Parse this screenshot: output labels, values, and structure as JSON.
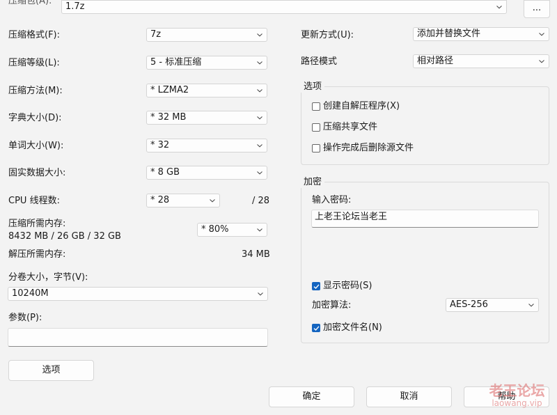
{
  "archive": {
    "label": "压缩包(A):",
    "path": "1.7z",
    "browse_label": "..."
  },
  "left": {
    "format": {
      "label": "压缩格式(F):",
      "value": "7z"
    },
    "level": {
      "label": "压缩等级(L):",
      "value": "5 - 标准压缩"
    },
    "method": {
      "label": "压缩方法(M):",
      "value": "*  LZMA2"
    },
    "dict": {
      "label": "字典大小(D):",
      "value": "*  32 MB"
    },
    "word": {
      "label": "单词大小(W):",
      "value": "*  32"
    },
    "solid": {
      "label": "固实数据大小:",
      "value": "*  8 GB"
    },
    "threads": {
      "label": "CPU 线程数:",
      "value": "*  28",
      "max": "/ 28"
    },
    "mem_compress": {
      "label": "压缩所需内存:",
      "detail": "8432 MB / 26 GB / 32 GB",
      "value": "*  80%"
    },
    "mem_decompress": {
      "label": "解压所需内存:",
      "value": "34 MB"
    },
    "volume": {
      "label": "分卷大小，字节(V):",
      "value": "10240M"
    },
    "params": {
      "label": "参数(P):",
      "value": ""
    },
    "options_button": "选项"
  },
  "right": {
    "update": {
      "label": "更新方式(U):",
      "value": "添加并替换文件"
    },
    "pathmode": {
      "label": "路径模式",
      "value": "相对路径"
    },
    "options_group": {
      "title": "选项",
      "sfx": "创建自解压程序(X)",
      "shared": "压缩共享文件",
      "delete": "操作完成后删除源文件"
    },
    "encryption": {
      "title": "加密",
      "password_label": "输入密码:",
      "password_value": "上老王论坛当老王",
      "show_password": "显示密码(S)",
      "method_label": "加密算法:",
      "method_value": "AES-256",
      "encrypt_names": "加密文件名(N)"
    }
  },
  "buttons": {
    "ok": "确定",
    "cancel": "取消",
    "help": "帮助"
  },
  "watermark": {
    "line1": "老王论坛",
    "line2": "laowang.vip"
  },
  "colors": {
    "checkbox_on": "#1565c0",
    "watermark": "#e07a7a"
  }
}
